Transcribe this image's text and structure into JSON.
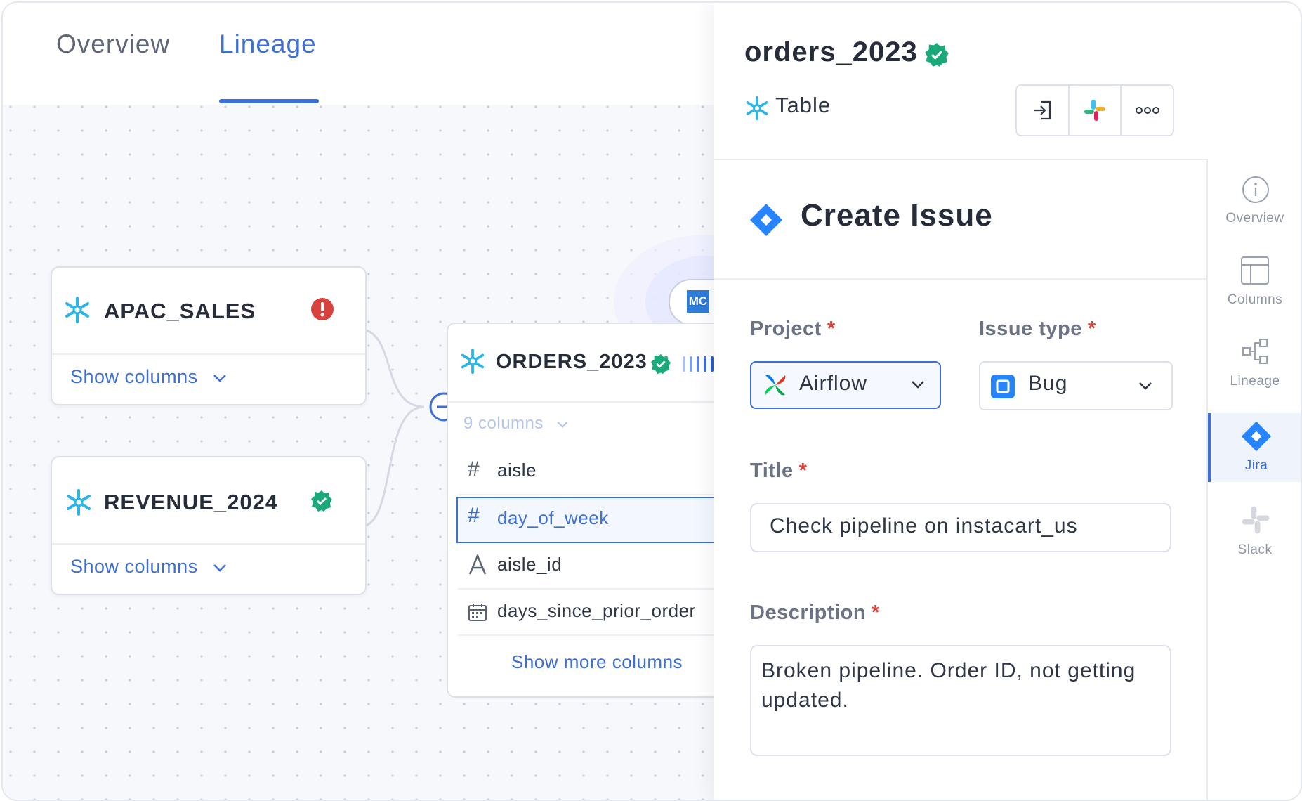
{
  "tabs": {
    "overview": "Overview",
    "lineage": "Lineage",
    "active": "Lineage"
  },
  "lineage": {
    "nodes": [
      {
        "name": "APAC_SALES",
        "status": "error",
        "action": "Show columns"
      },
      {
        "name": "REVENUE_2024",
        "status": "verified",
        "action": "Show columns"
      }
    ],
    "target": {
      "name": "ORDERS_2023",
      "status": "verified",
      "badge": "MC",
      "columns_summary": "9 columns",
      "columns": [
        {
          "name": "aisle",
          "type": "number",
          "selected": false
        },
        {
          "name": "day_of_week",
          "type": "number",
          "selected": true
        },
        {
          "name": "aisle_id",
          "type": "text",
          "selected": false
        },
        {
          "name": "days_since_prior_order",
          "type": "date",
          "selected": false
        }
      ],
      "more": "Show more columns"
    }
  },
  "panel": {
    "title": "orders_2023",
    "title_status": "verified",
    "subtitle": "Table",
    "actions": [
      "enter-icon",
      "slack-icon",
      "more-icon"
    ],
    "form": {
      "heading": "Create Issue",
      "project_label": "Project",
      "project_value": "Airflow",
      "issue_type_label": "Issue type",
      "issue_type_value": "Bug",
      "title_label": "Title",
      "title_value": "Check pipeline on instacart_us",
      "description_label": "Description",
      "description_value": "Broken pipeline. Order ID, not getting updated.",
      "required_mark": "*"
    },
    "rail": [
      {
        "label": "Overview",
        "icon": "info-icon",
        "active": false
      },
      {
        "label": "Columns",
        "icon": "columns-icon",
        "active": false
      },
      {
        "label": "Lineage",
        "icon": "lineage-icon",
        "active": false
      },
      {
        "label": "Jira",
        "icon": "jira-icon",
        "active": true
      },
      {
        "label": "Slack",
        "icon": "slack-icon",
        "active": false
      }
    ]
  },
  "colors": {
    "accent": "#3d6fd6",
    "verified": "#1aaa7a",
    "error": "#d8423c",
    "snowflake": "#29b5e8",
    "jira": "#2684ff"
  }
}
